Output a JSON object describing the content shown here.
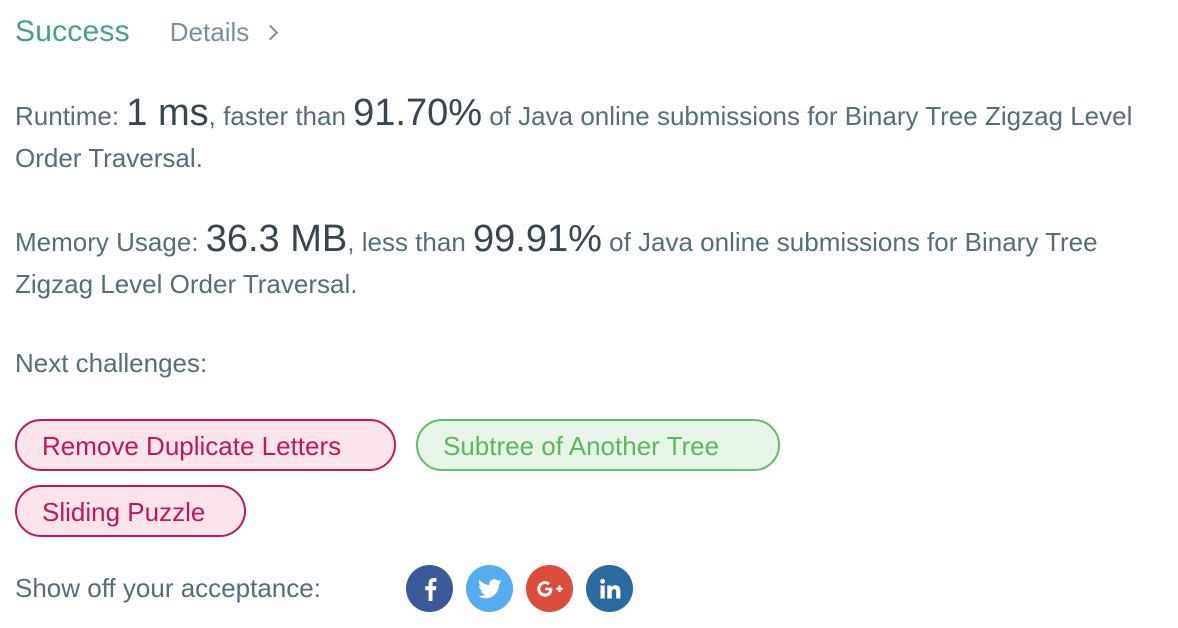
{
  "header": {
    "status": "Success",
    "details_label": "Details"
  },
  "runtime": {
    "label": "Runtime: ",
    "value": "1 ms",
    "mid": ", faster than ",
    "percent": "91.70%",
    "tail": " of Java online submissions for Binary Tree Zigzag Level Order Traversal."
  },
  "memory": {
    "label": "Memory Usage: ",
    "value": "36.3 MB",
    "mid": ", less than ",
    "percent": "99.91%",
    "tail": " of Java online submissions for Binary Tree Zigzag Level Order Traversal."
  },
  "next_challenges": {
    "label": "Next challenges:",
    "items": [
      {
        "label": "Remove Duplicate Letters",
        "difficulty_color": "#c2185b"
      },
      {
        "label": "Subtree of Another Tree",
        "difficulty_color": "#66bb6a"
      },
      {
        "label": "Sliding Puzzle",
        "difficulty_color": "#c2185b"
      }
    ]
  },
  "share": {
    "label": "Show off your acceptance:",
    "buttons": [
      {
        "icon": "facebook-icon",
        "color": "#3b5998"
      },
      {
        "icon": "twitter-icon",
        "color": "#55acee"
      },
      {
        "icon": "google-plus-icon",
        "color": "#dd4b39"
      },
      {
        "icon": "linkedin-icon",
        "color": "#2a6a9e"
      }
    ]
  }
}
